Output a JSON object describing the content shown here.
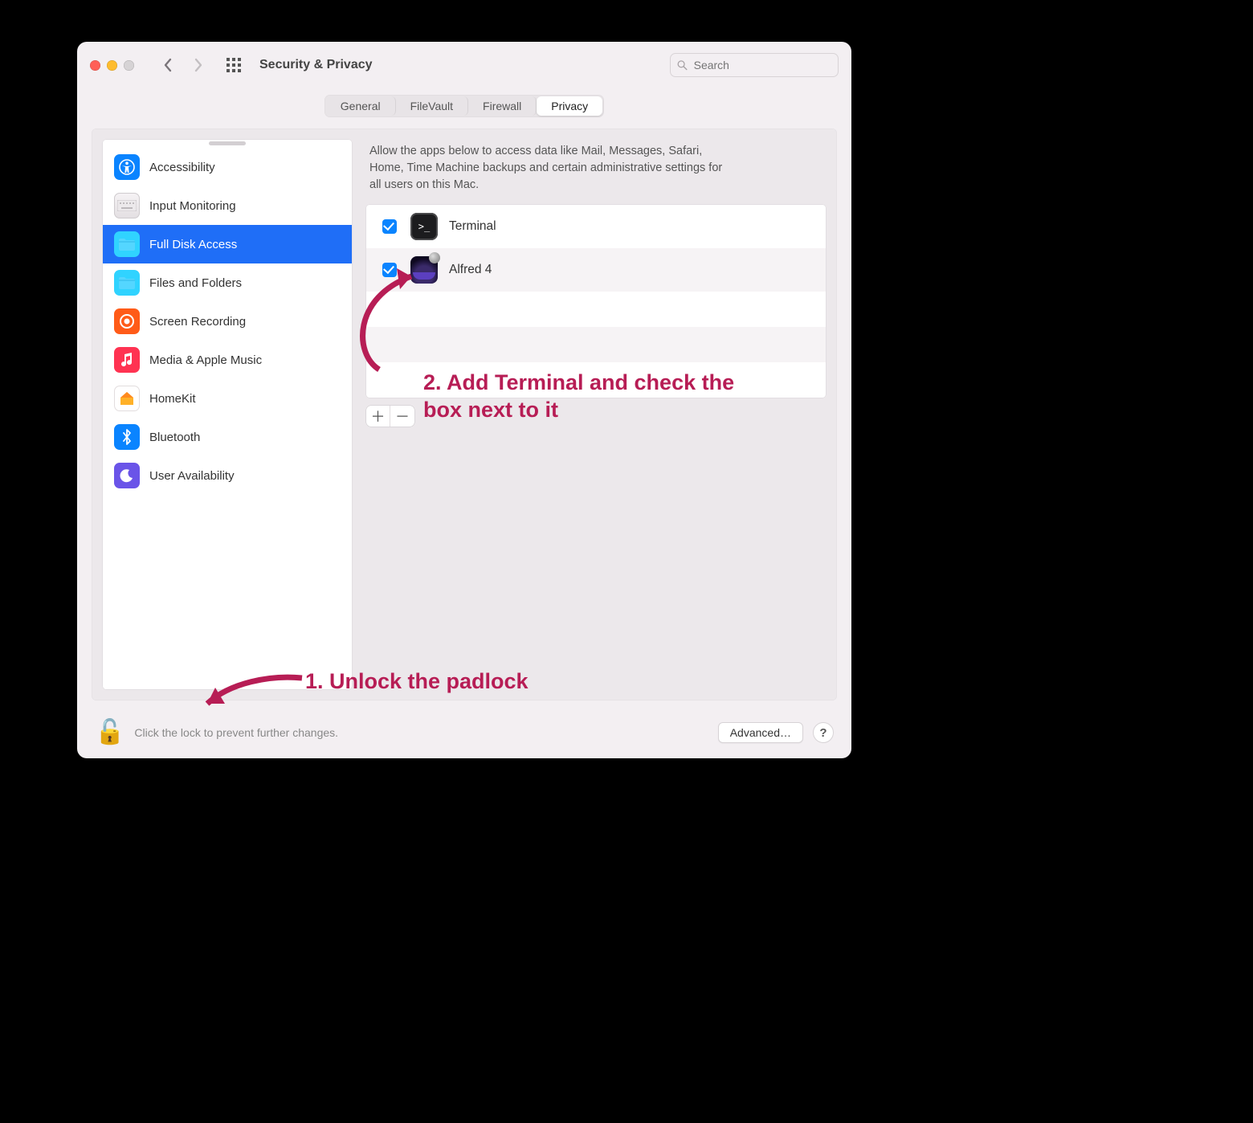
{
  "window": {
    "title": "Security & Privacy"
  },
  "search": {
    "placeholder": "Search"
  },
  "tabs": {
    "general": "General",
    "filevault": "FileVault",
    "firewall": "Firewall",
    "privacy": "Privacy"
  },
  "sidebar": {
    "items": [
      {
        "label": "Accessibility"
      },
      {
        "label": "Input Monitoring"
      },
      {
        "label": "Full Disk Access"
      },
      {
        "label": "Files and Folders"
      },
      {
        "label": "Screen Recording"
      },
      {
        "label": "Media & Apple Music"
      },
      {
        "label": "HomeKit"
      },
      {
        "label": "Bluetooth"
      },
      {
        "label": "User Availability"
      }
    ]
  },
  "pane": {
    "description": "Allow the apps below to access data like Mail, Messages, Safari, Home, Time Machine backups and certain administrative settings for all users on this Mac.",
    "apps": [
      {
        "name": "Terminal",
        "checked": true
      },
      {
        "name": "Alfred 4",
        "checked": true
      }
    ]
  },
  "footer": {
    "lock_text": "Click the lock to prevent further changes.",
    "advanced": "Advanced…",
    "help": "?"
  },
  "annotations": {
    "step1": "1. Unlock the padlock",
    "step2": "2. Add Terminal and check the box next to it"
  },
  "colors": {
    "annotation": "#b71d55",
    "selection": "#1f6ef7",
    "accent": "#0a84ff"
  }
}
